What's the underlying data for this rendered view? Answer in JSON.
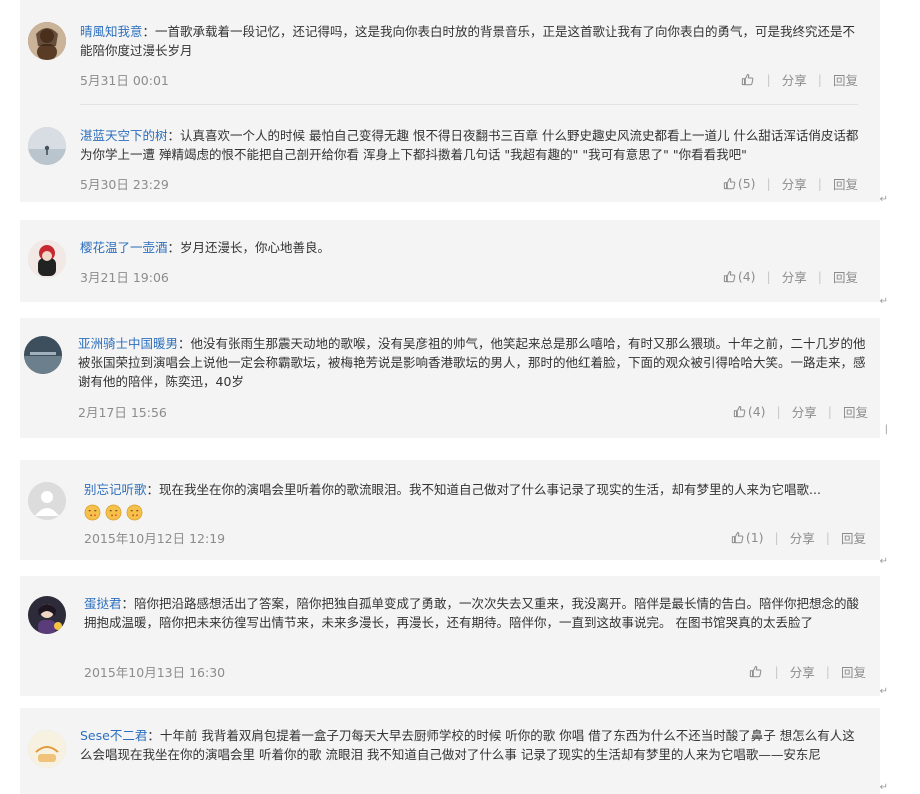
{
  "actions": {
    "share_label": "分享",
    "reply_label": "回复"
  },
  "comments": [
    {
      "username": "晴風知我意",
      "text": "一首歌承载着一段记忆，还记得吗，这是我向你表白时放的背景音乐，正是这首歌让我有了向你表白的勇气，可是我终究还是不能陪你度过漫长岁月",
      "time": "5月31日 00:01",
      "likes": ""
    },
    {
      "username": "湛蓝天空下的树",
      "text": "认真喜欢一个人的时候 最怕自己变得无趣 恨不得日夜翻书三百章 什么野史趣史风流史都看上一道儿 什么甜话浑话俏皮话都为你学上一遭 殚精竭虑的恨不能把自己剖开给你看 浑身上下都抖擞着几句话 \"我超有趣的\" \"我可有意思了\" \"你看看我吧\"",
      "time": "5月30日 23:29",
      "likes": "(5)"
    },
    {
      "username": "樱花温了一壶酒",
      "text": "岁月还漫长，你心地善良。",
      "time": "3月21日 19:06",
      "likes": "(4)"
    },
    {
      "username": "亚洲骑士中国暖男",
      "text": "他没有张雨生那震天动地的歌喉，没有吴彦祖的帅气，他笑起来总是那么嘻哈，有时又那么猥琐。十年之前，二十几岁的他被张国荣拉到演唱会上说他一定会称霸歌坛，被梅艳芳说是影响香港歌坛的男人，那时的他红着脸，下面的观众被引得哈哈大笑。一路走来，感谢有他的陪伴，陈奕迅，40岁",
      "time": "2月17日 15:56",
      "likes": "(4)"
    },
    {
      "username": "别忘记听歌",
      "text": "现在我坐在你的演唱会里听着你的歌流眼泪。我不知道自己做对了什么事记录了现实的生活，却有梦里的人来为它唱歌...",
      "time": "2015年10月12日 12:19",
      "likes": "(1)"
    },
    {
      "username": "蛋挞君",
      "text": "陪你把沿路感想活出了答案，陪你把独自孤单变成了勇敢，一次次失去又重来，我没离开。陪伴是最长情的告白。陪伴你把想念的酸拥抱成温暖，陪你把未来彷徨写出情节来，未来多漫长，再漫长，还有期待。陪伴你，一直到这故事说完。 在图书馆哭真的太丢脸了",
      "time": "2015年10月13日 16:30",
      "likes": ""
    },
    {
      "username": "Sese不二君",
      "text": "十年前 我背着双肩包提着一盒子刀每天大早去厨师学校的时候 听你的歌 你唱 借了东西为什么不还当时酸了鼻子 想怎么有人这么会唱现在我坐在你的演唱会里 听着你的歌 流眼泪 我不知道自己做对了什么事 记录了现实的生活却有梦里的人来为它唱歌——安东尼"
    }
  ],
  "colors": {
    "username": "#2d6fbd",
    "text": "#333333",
    "meta": "#8c8c8c",
    "card_bg": "#f4f4f4"
  },
  "icons": {
    "like": "thumbs-up-icon",
    "emoji": "kiss-face-emoji-icon",
    "mark": "paragraph-mark-icon"
  }
}
